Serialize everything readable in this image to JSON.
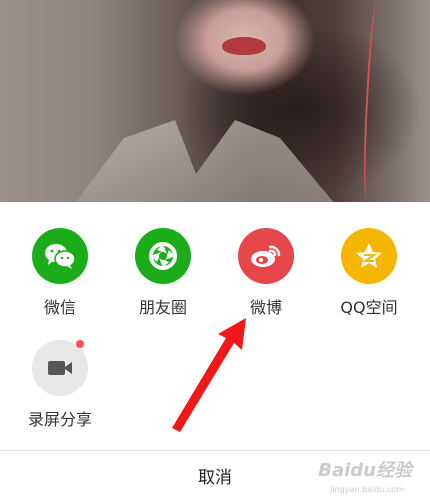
{
  "share_sheet": {
    "items": [
      {
        "label": "微信",
        "icon": "wechat-icon",
        "color": "#1aad19"
      },
      {
        "label": "朋友圈",
        "icon": "moments-icon",
        "color": "#1aad19"
      },
      {
        "label": "微博",
        "icon": "weibo-icon",
        "color": "#e6474b"
      },
      {
        "label": "QQ空间",
        "icon": "qzone-icon",
        "color": "#f6b600"
      }
    ],
    "screen_record": {
      "label": "录屏分享",
      "icon": "video-camera-icon",
      "color": "#e8e8e8"
    },
    "cancel_label": "取消"
  },
  "watermark": {
    "text": "Baidu经验",
    "sub": "jingyan.baidu.com"
  }
}
